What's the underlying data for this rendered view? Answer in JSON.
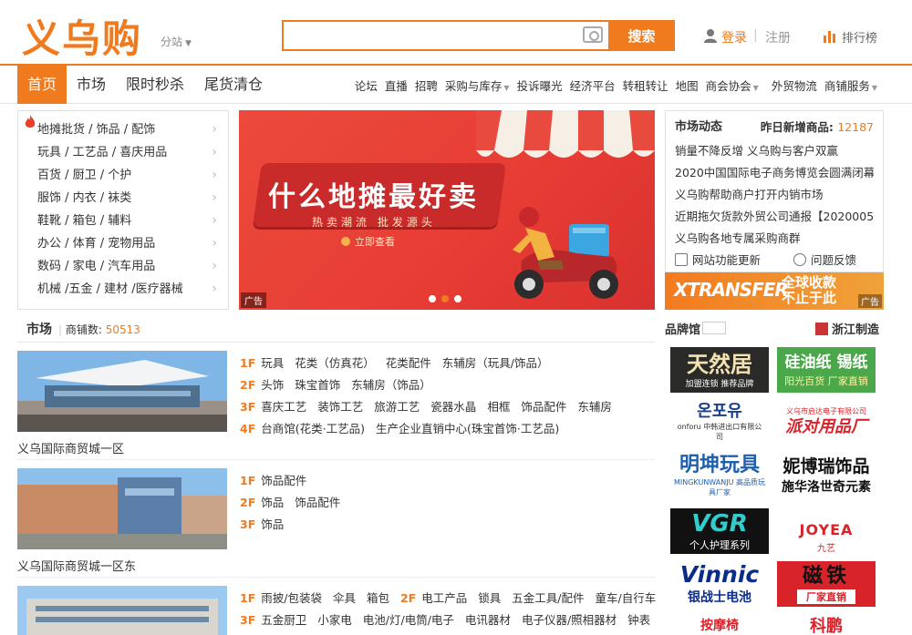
{
  "header": {
    "logo": "义乌购",
    "substation": "分站",
    "search_placeholder": "",
    "search_button": "搜索",
    "login": "登录",
    "register": "注册",
    "rank": "排行榜"
  },
  "nav": {
    "main": [
      "首页",
      "市场",
      "限时秒杀",
      "尾货清仓"
    ],
    "sub": [
      {
        "label": "论坛",
        "dropdown": false
      },
      {
        "label": "直播",
        "dropdown": false
      },
      {
        "label": "招聘",
        "dropdown": false
      },
      {
        "label": "采购与库存",
        "dropdown": true
      },
      {
        "label": "投诉曝光",
        "dropdown": false
      },
      {
        "label": "经济平台",
        "dropdown": false
      },
      {
        "label": "转租转让",
        "dropdown": false
      },
      {
        "label": "地图",
        "dropdown": false
      },
      {
        "label": "商会协会",
        "dropdown": true
      },
      {
        "label": "外贸物流",
        "dropdown": false
      },
      {
        "label": "商铺服务",
        "dropdown": true
      }
    ]
  },
  "categories": [
    "地摊批货 / 饰品 / 配饰",
    "玩具 / 工艺品 / 喜庆用品",
    "百货 / 厨卫 / 个护",
    "服饰 / 内衣 / 袜类",
    "鞋靴 / 箱包 / 辅料",
    "办公 / 体育 / 宠物用品",
    "数码 / 家电 / 汽车用品",
    "机械 /五金 / 建材 /医疗器械"
  ],
  "banner": {
    "title": "什么地摊最好卖",
    "subtitle": "热卖潮流 批发源头",
    "cta": "立即查看",
    "ad_tag": "广告"
  },
  "market_dynamics": {
    "title": "市场动态",
    "new_label": "昨日新增商品:",
    "new_count": "12187",
    "news": [
      "销量不降反增 义乌购与客户双赢",
      "2020中国国际电子商务博览会圆满闭幕",
      "义乌购帮助商户打开内销市场",
      "近期拖欠货款外贸公司通报【2020005】",
      "义乌购各地专属采购商群"
    ],
    "feature_update": "网站功能更新",
    "feedback": "问题反馈"
  },
  "xtransfer": {
    "logo": "XTRANSFER",
    "line1": "全球收款",
    "line2": "不止于此",
    "ad_tag": "广告"
  },
  "market": {
    "title": "市场",
    "count_label": "商铺数:",
    "count": "50513",
    "items": [
      {
        "name": "义乌国际商贸城一区",
        "floors": [
          {
            "floor": "1F",
            "cats": [
              "玩具",
              "花类（仿真花）",
              "花类配件",
              "东辅房（玩具/饰品）"
            ]
          },
          {
            "floor": "2F",
            "cats": [
              "头饰",
              "珠宝首饰",
              "东辅房（饰品）"
            ]
          },
          {
            "floor": "3F",
            "cats": [
              "喜庆工艺",
              "装饰工艺",
              "旅游工艺",
              "瓷器水晶",
              "相框",
              "饰品配件",
              "东辅房"
            ]
          },
          {
            "floor": "4F",
            "cats": [
              "台商馆(花类·工艺品)",
              "生产企业直销中心(珠宝首饰·工艺品)"
            ]
          }
        ]
      },
      {
        "name": "义乌国际商贸城一区东",
        "floors": [
          {
            "floor": "1F",
            "cats": [
              "饰品配件"
            ]
          },
          {
            "floor": "2F",
            "cats": [
              "饰品",
              "饰品配件"
            ]
          },
          {
            "floor": "3F",
            "cats": [
              "饰品"
            ]
          }
        ]
      },
      {
        "name": "",
        "floors": [
          {
            "floor": "1F",
            "cats": [
              "雨披/包装袋",
              "伞具",
              "箱包"
            ],
            "floor2": "2F",
            "cats2": [
              "电工产品",
              "锁具",
              "五金工具/配件",
              "童车/自行车"
            ]
          },
          {
            "floor": "3F",
            "cats": [
              "五金厨卫",
              "小家电",
              "电池/灯/电筒/电子",
              "电讯器材",
              "电子仪器/照相器材",
              "钟表"
            ]
          }
        ]
      }
    ]
  },
  "brand_hall": {
    "title": "品牌馆",
    "right_label": "浙江制造",
    "brands": [
      {
        "name": "天然居",
        "sub": "加盟连锁 推荐品牌"
      },
      {
        "name": "硅油纸 锡纸",
        "sub": "阳光百货 厂家直销"
      },
      {
        "name": "온포유",
        "sub": "onforu 中韩进出口有限公司"
      },
      {
        "name": "派对用品厂",
        "sub": "义乌市启达电子有限公司"
      },
      {
        "name": "明坤玩具",
        "sub": "MINGKUNWANJU 高品质玩具厂家"
      },
      {
        "name": "妮博瑞饰品",
        "sub": "施华洛世奇元素"
      },
      {
        "name": "VGR",
        "sub": "个人护理系列"
      },
      {
        "name": "JOYEA",
        "sub": "九艺"
      },
      {
        "name": "Vinnic",
        "sub": "银战士电池"
      },
      {
        "name": "磁铁",
        "sub": "厂家直销"
      },
      {
        "name": "按摩椅",
        "sub": ""
      },
      {
        "name": "科鹏",
        "sub": ""
      }
    ]
  }
}
